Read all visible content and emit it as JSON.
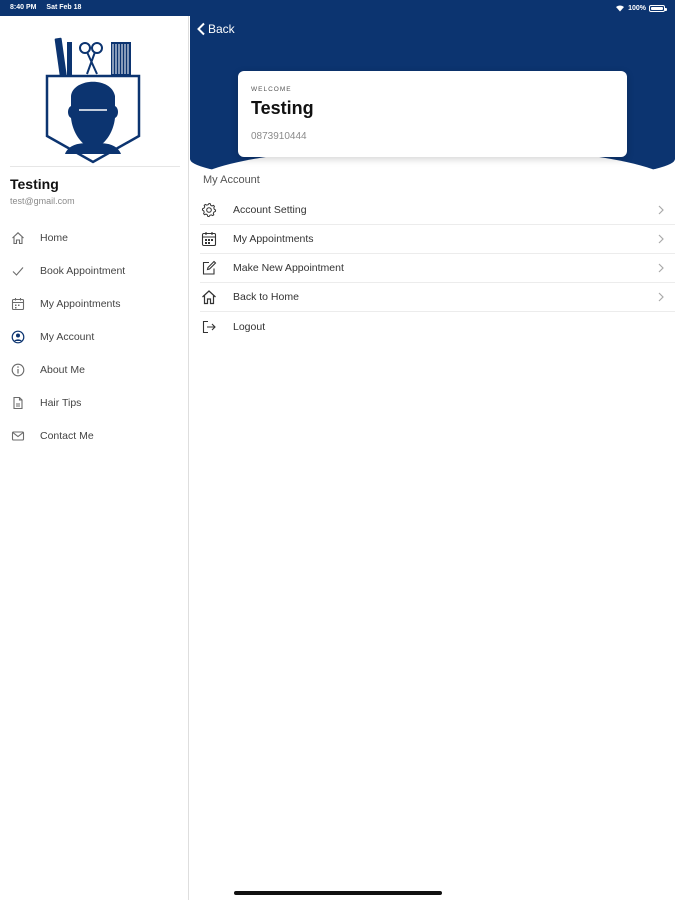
{
  "status_bar": {
    "time": "8:40 PM",
    "date": "Sat Feb 18",
    "battery": "100%"
  },
  "sidebar": {
    "profile_name": "Testing",
    "profile_email": "test@gmail.com",
    "items": [
      {
        "label": "Home",
        "icon": "home-icon"
      },
      {
        "label": "Book Appointment",
        "icon": "check-icon"
      },
      {
        "label": "My Appointments",
        "icon": "calendar-icon"
      },
      {
        "label": "My Account",
        "icon": "user-circle-icon"
      },
      {
        "label": "About Me",
        "icon": "info-icon"
      },
      {
        "label": "Hair Tips",
        "icon": "document-icon"
      },
      {
        "label": "Contact Me",
        "icon": "mail-icon"
      }
    ]
  },
  "header": {
    "back_label": "Back"
  },
  "welcome_card": {
    "tag": "WELCOME",
    "name": "Testing",
    "phone": "0873910444"
  },
  "account": {
    "section_title": "My Account",
    "items": [
      {
        "label": "Account Setting",
        "icon": "gear-icon",
        "chevron": true
      },
      {
        "label": "My Appointments",
        "icon": "calendar-icon",
        "chevron": true
      },
      {
        "label": "Make New Appointment",
        "icon": "edit-icon",
        "chevron": true
      },
      {
        "label": "Back to Home",
        "icon": "home-icon",
        "chevron": true
      },
      {
        "label": "Logout",
        "icon": "logout-icon",
        "chevron": false
      }
    ]
  },
  "colors": {
    "brand": "#0c3470",
    "divider": "#ececec",
    "text": "#333333"
  }
}
